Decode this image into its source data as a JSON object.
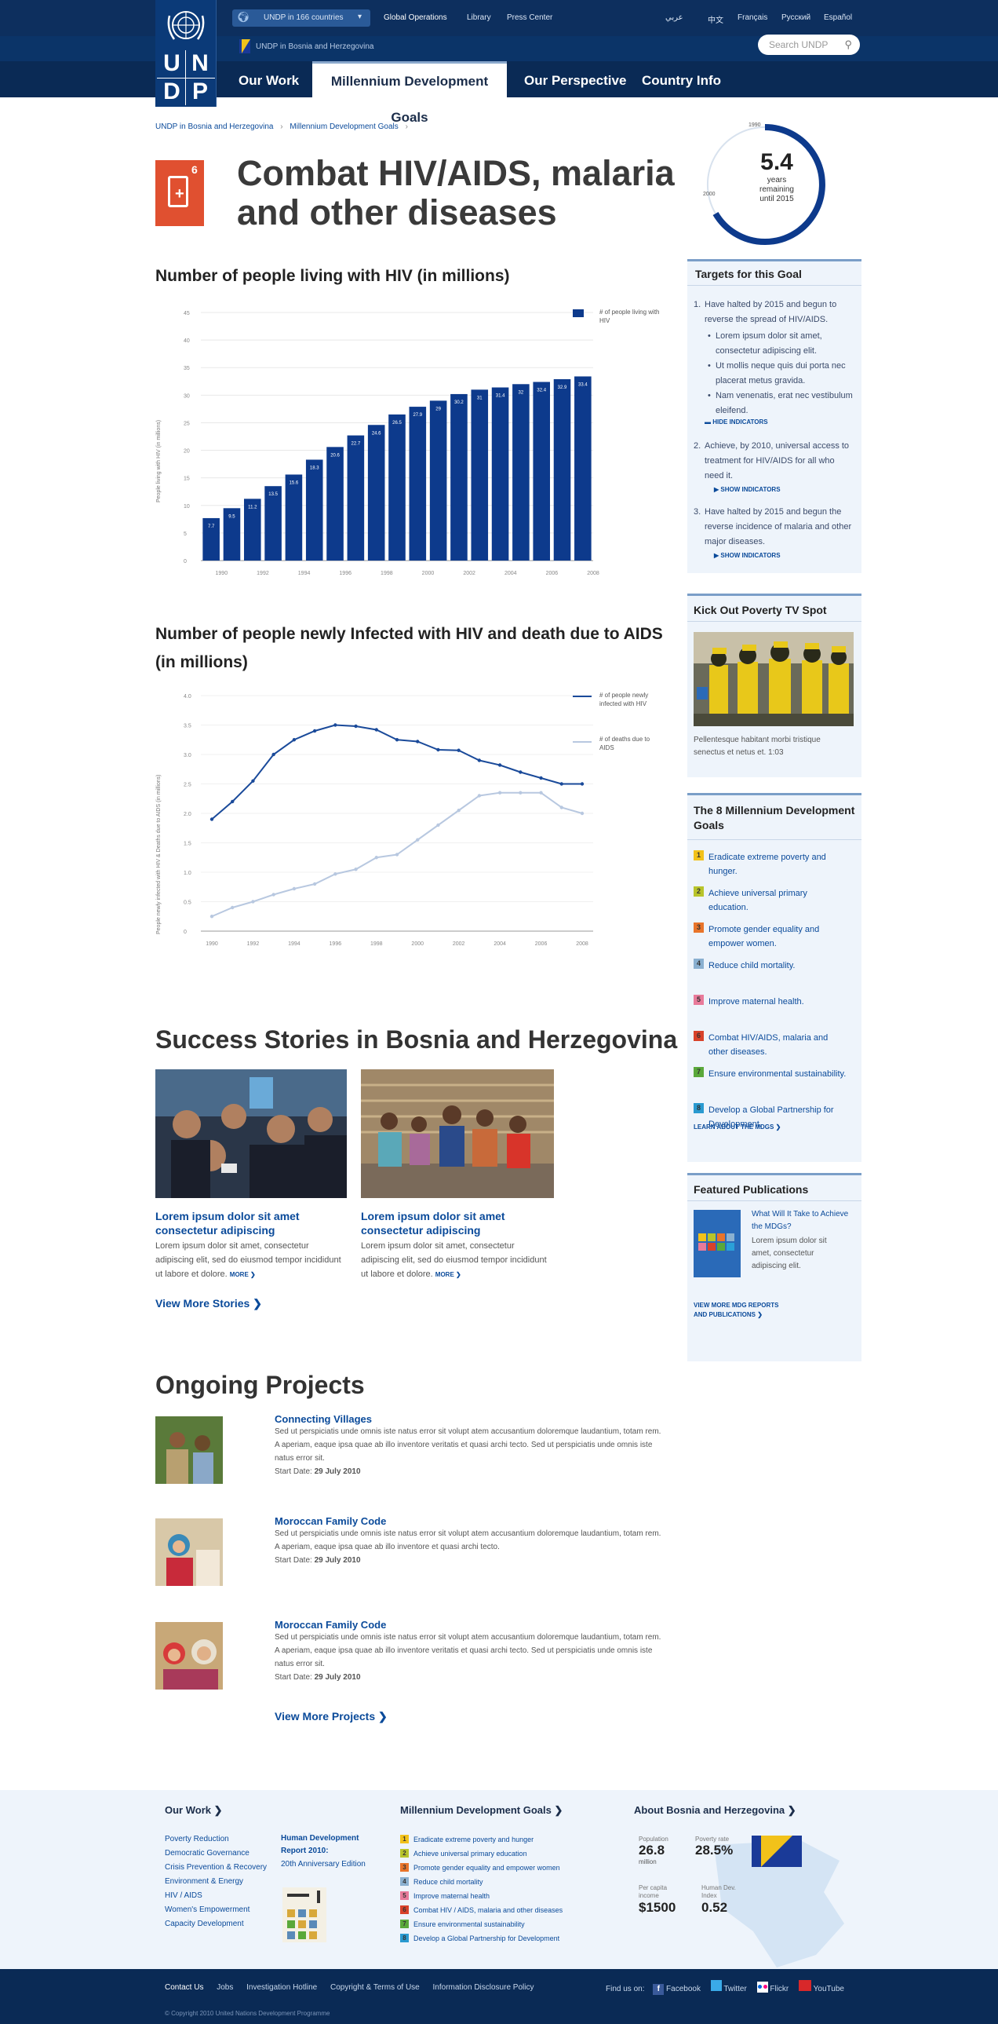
{
  "header": {
    "logo_letters": [
      "U",
      "N",
      "D",
      "P"
    ],
    "locations_dropdown": "UNDP in 166 countries",
    "top_links": [
      "Global Operations",
      "Library",
      "Press Center"
    ],
    "languages": [
      "عربي",
      "中文",
      "Français",
      "Русский",
      "Español"
    ],
    "subtitle": "UNDP in Bosnia and Herzegovina",
    "search_placeholder": "Search UNDP",
    "nav": [
      "Our Work",
      "Millennium Development Goals",
      "Our Perspective",
      "Country Info"
    ]
  },
  "breadcrumb": [
    "UNDP in Bosnia and Herzegovina",
    "Millennium Development Goals"
  ],
  "goal": {
    "number": "6",
    "title_line1": "Combat HIV/AIDS, malaria",
    "title_line2": "and other diseases"
  },
  "countdown": {
    "value": "5.4",
    "line1": "years",
    "line2": "remaining",
    "line3": "until 2015",
    "start_label": "2000",
    "top_label": "1990"
  },
  "chart1": {
    "title": "Number of people living with HIV (in millions)",
    "ylabel": "People living with HIV (in millions)",
    "legend": "# of people living with HIV"
  },
  "chart2": {
    "title_line1": "Number of people newly Infected with HIV and death due to AIDS",
    "title_line2": "(in millions)",
    "ylabel": "People newly infected with HIV & Deaths due to AIDS (in millions)",
    "legend1": "# of people newly infected with HIV",
    "legend2": "# of deaths due to AIDS"
  },
  "chart_data": [
    {
      "type": "bar",
      "title": "Number of people living with HIV (in millions)",
      "ylabel": "People living with HIV (in millions)",
      "categories": [
        "1990",
        "1991",
        "1992",
        "1993",
        "1994",
        "1995",
        "1996",
        "1997",
        "1998",
        "1999",
        "2000",
        "2001",
        "2002",
        "2003",
        "2004",
        "2005",
        "2006",
        "2007",
        "2008"
      ],
      "tick_labels": [
        "1990",
        "1992",
        "1994",
        "1996",
        "1998",
        "2000",
        "2002",
        "2004",
        "2006",
        "2008"
      ],
      "values": [
        7.7,
        9.5,
        11.2,
        13.5,
        15.6,
        18.3,
        20.6,
        22.7,
        24.6,
        26.5,
        27.9,
        29.0,
        30.2,
        31.0,
        31.4,
        32.0,
        32.4,
        32.9,
        33.4
      ],
      "labels": [
        "7.7",
        "9.5",
        "11.2",
        "13.5",
        "15.6",
        "18.3",
        "20.6",
        "22.7",
        "24.6",
        "26.5",
        "27.9",
        "29",
        "30.2",
        "31",
        "31.4",
        "32",
        "32.4",
        "32.9",
        "33.4"
      ],
      "ylim": [
        0,
        45
      ],
      "yticks": [
        "0",
        "5",
        "10",
        "15",
        "20",
        "25",
        "30",
        "35",
        "40",
        "45"
      ],
      "series": [
        {
          "name": "# of people living with HIV",
          "color": "#0d3a8c"
        }
      ],
      "legend": "top-right"
    },
    {
      "type": "line",
      "title": "Number of people newly Infected with HIV and death due to AIDS (in millions)",
      "ylabel": "People newly infected with HIV & Deaths due to AIDS (in millions)",
      "categories": [
        "1990",
        "1991",
        "1992",
        "1993",
        "1994",
        "1995",
        "1996",
        "1997",
        "1998",
        "1999",
        "2000",
        "2001",
        "2002",
        "2003",
        "2004",
        "2005",
        "2006",
        "2007",
        "2008"
      ],
      "tick_labels": [
        "1990",
        "1992",
        "1994",
        "1996",
        "1998",
        "2000",
        "2002",
        "2004",
        "2006",
        "2008"
      ],
      "ylim": [
        0,
        4.0
      ],
      "yticks": [
        "0",
        "0.5",
        "1.0",
        "1.5",
        "2.0",
        "2.5",
        "3.0",
        "3.5",
        "4.0"
      ],
      "series": [
        {
          "name": "# of people newly infected with HIV",
          "color": "#1a4a9a",
          "values": [
            1.9,
            2.2,
            2.55,
            3.0,
            3.25,
            3.4,
            3.5,
            3.48,
            3.42,
            3.25,
            3.22,
            3.08,
            3.07,
            2.9,
            2.82,
            2.7,
            2.6,
            2.5,
            2.5
          ]
        },
        {
          "name": "# of deaths due to AIDS",
          "color": "#b8c8e0",
          "values": [
            0.25,
            0.4,
            0.5,
            0.62,
            0.72,
            0.8,
            0.97,
            1.05,
            1.25,
            1.3,
            1.55,
            1.8,
            2.05,
            2.3,
            2.35,
            2.35,
            2.35,
            2.1,
            2.0
          ]
        }
      ],
      "legend": "top-right"
    }
  ],
  "targets": {
    "title": "Targets for this Goal",
    "t1_num": "1.",
    "t1": "Have halted by 2015 and begun to reverse the spread of HIV/AIDS.",
    "bullets": [
      "Lorem ipsum dolor sit amet, consectetur adipiscing elit.",
      "Ut mollis neque quis dui porta nec placerat metus gravida.",
      "Nam venenatis, erat nec vestibulum eleifend."
    ],
    "hide": "HIDE INDICATORS",
    "t2_num": "2.",
    "t2": "Achieve, by 2010, universal access to treatment for HIV/AIDS for all who need it.",
    "t3_num": "3.",
    "t3": "Have halted by 2015 and begun the reverse incidence of malaria and other major diseases.",
    "show": "SHOW INDICATORS"
  },
  "tvspot": {
    "title": "Kick Out Poverty TV Spot",
    "caption": "Pellentesque habitant morbi tristique senectus et netus et.  1:03"
  },
  "mdgs": {
    "title_line1": "The 8 Millennium Development",
    "title_line2": "Goals",
    "items": [
      {
        "n": "1",
        "label": "Eradicate extreme poverty and hunger.",
        "color": "#f2c21a"
      },
      {
        "n": "2",
        "label": "Achieve universal primary education.",
        "color": "#b8c42a"
      },
      {
        "n": "3",
        "label": "Promote gender equality and empower women.",
        "color": "#e8742a"
      },
      {
        "n": "4",
        "label": "Reduce child mortality.",
        "color": "#8ab0d0"
      },
      {
        "n": "5",
        "label": "Improve maternal health.",
        "color": "#e87a9a"
      },
      {
        "n": "6",
        "label": "Combat HIV/AIDS, malaria and other diseases.",
        "color": "#d8422a"
      },
      {
        "n": "7",
        "label": "Ensure environmental sustainability.",
        "color": "#5aa83a"
      },
      {
        "n": "8",
        "label": "Develop a Global Partnership for Development.",
        "color": "#2a9ad0"
      }
    ],
    "learn": "LEARN ABOUT THE MDGS"
  },
  "publications": {
    "title": "Featured Publications",
    "pub_title": "What Will It Take to Achieve the MDGs?",
    "pub_text": "Lorem ipsum dolor sit amet, consectetur adipiscing elit.",
    "view_line1": "VIEW MORE MDG REPORTS",
    "view_line2": "AND PUBLICATIONS"
  },
  "stories": {
    "title": "Success Stories in Bosnia and Herzegovina",
    "items": [
      {
        "title_line1": "Lorem ipsum dolor sit amet",
        "title_line2": "consectetur adipiscing",
        "text": "Lorem ipsum dolor sit amet, consectetur adipiscing elit, sed do eiusmod tempor incididunt ut labore et dolore.",
        "more": "MORE"
      },
      {
        "title_line1": "Lorem ipsum dolor sit amet",
        "title_line2": "consectetur adipiscing",
        "text": "Lorem ipsum dolor sit amet, consectetur adipiscing elit, sed do eiusmod tempor incididunt ut labore et dolore.",
        "more": "MORE"
      }
    ],
    "view_more": "View More Stories"
  },
  "projects": {
    "title": "Ongoing Projects",
    "items": [
      {
        "title": "Connecting Villages",
        "text": "Sed ut perspiciatis unde omnis iste natus error sit volupt atem accusantium doloremque laudantium, totam rem. A aperiam, eaque ipsa quae ab illo inventore veritatis et quasi archi tecto.  Sed ut perspiciatis unde omnis iste natus error sit.",
        "start_label": "Start Date:",
        "date": "29 July 2010"
      },
      {
        "title": "Moroccan Family Code",
        "text": "Sed ut perspiciatis unde omnis iste natus error sit volupt atem accusantium doloremque laudantium, totam rem. A aperiam, eaque ipsa quae ab illo inventore et quasi archi tecto.",
        "start_label": "Start Date:",
        "date": "29 July 2010"
      },
      {
        "title": "Moroccan Family Code",
        "text": "Sed ut perspiciatis unde omnis iste natus error sit volupt atem accusantium doloremque laudantium, totam rem. A aperiam, eaque ipsa quae ab illo inventore veritatis et quasi archi tecto.  Sed ut perspiciatis unde omnis iste natus error sit.",
        "start_label": "Start Date:",
        "date": "29 July 2010"
      }
    ],
    "view_more": "View More Projects"
  },
  "footer": {
    "ourwork_title": "Our Work",
    "ourwork_links": [
      "Poverty Reduction",
      "Democratic Governance",
      "Crisis Prevention & Recovery",
      "Environment & Energy",
      "HIV / AIDS",
      "Women's Empowerment",
      "Capacity Development"
    ],
    "hdr_title_line1": "Human Development",
    "hdr_title_line2": "Report 2010:",
    "hdr_sub": "20th Anniversary Edition",
    "mdg_title": "Millennium Development Goals",
    "mdg_links": [
      "Eradicate extreme poverty and hunger",
      "Achieve universal primary education",
      "Promote gender equality and empower women",
      "Reduce child mortality",
      "Improve maternal health",
      "Combat HIV / AIDS, malaria and other diseases",
      "Ensure environmental sustainability",
      "Develop a Global Partnership for Development"
    ],
    "about_title": "About Bosnia and Herzegovina",
    "stats": [
      {
        "label": "Population",
        "value": "26.8",
        "unit": "million"
      },
      {
        "label": "Poverty rate",
        "value": "28.5%",
        "unit": ""
      },
      {
        "label": "Per capita income",
        "value": "$1500",
        "unit": ""
      },
      {
        "label": "Human Dev. Index",
        "value": "0.52",
        "unit": ""
      }
    ],
    "bottom_links": [
      "Contact Us",
      "Jobs",
      "Investigation Hotline",
      "Copyright & Terms of Use",
      "Information Disclosure Policy"
    ],
    "find_us": "Find us on:",
    "social": [
      "Facebook",
      "Twitter",
      "Flickr",
      "YouTube"
    ],
    "copyright": "© Copyright 2010 United Nations Development Programme"
  }
}
